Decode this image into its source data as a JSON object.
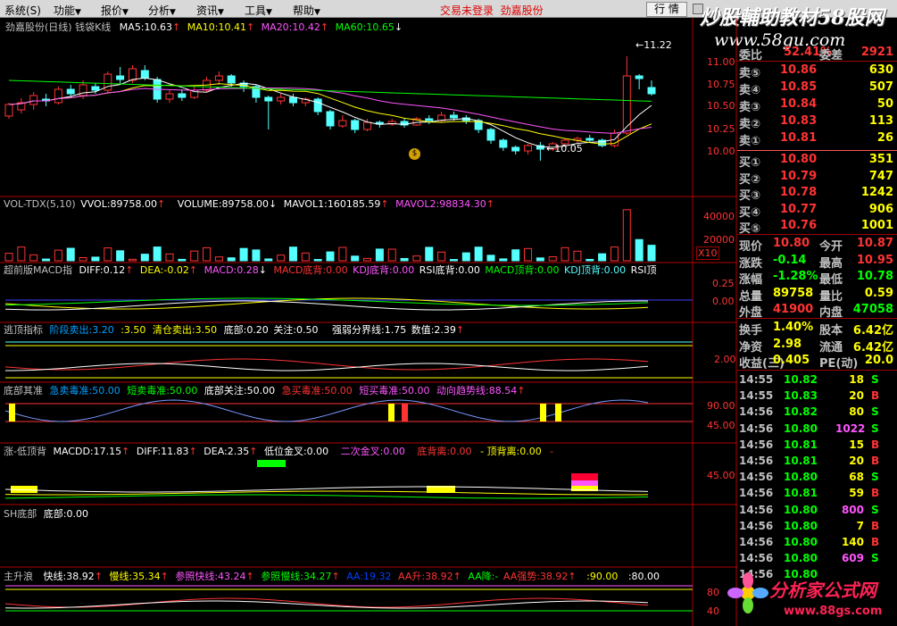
{
  "menu": [
    {
      "label": "系统(S)"
    },
    {
      "label": "功能"
    },
    {
      "label": "报价"
    },
    {
      "label": "分析"
    },
    {
      "label": "资讯"
    },
    {
      "label": "工具"
    },
    {
      "label": "帮助"
    }
  ],
  "trade_status": "交易未登录",
  "stock_name": "劲嘉股份",
  "market_button": "行 情",
  "watermark": {
    "title": "炒股輔助教材58股网",
    "url": "www.58gu.com",
    "logo": "分析家公式网",
    "logo_url": "www.88gs.com"
  },
  "colors": {
    "up": "#ff3333",
    "down": "#54ffff",
    "ma5": "#ffffff",
    "ma10": "#ffff00",
    "ma20": "#ff55ff",
    "ma60": "#00ff00",
    "panel_border": "#b00000"
  },
  "kline": {
    "header": {
      "title": "劲嘉股份(日线) 钱袋K线",
      "ma5": "MA5:10.63",
      "ma10": "MA10:10.41",
      "ma20": "MA20:10.42",
      "ma60": "MA60:10.65"
    },
    "price_labels": [
      "11.00",
      "10.75",
      "10.50",
      "10.25",
      "10.00"
    ],
    "high_label": "11.22",
    "low_label": "10.05"
  },
  "vol": {
    "header": {
      "name": "VOL-TDX(5,10)",
      "vvol": "VVOL:89758.00",
      "volume": "VOLUME:89758.00",
      "mavol1": "MAVOL1:160185.59",
      "mavol2": "MAVOL2:98834.30"
    },
    "axis": [
      "40000",
      "20000"
    ],
    "unit": "X10"
  },
  "macd": {
    "header": {
      "name": "超前版MACD指",
      "diff": "DIFF:0.12",
      "dea": "DEA:-0.02",
      "macd": "MACD:0.28",
      "macd_dibei": "MACD底背:0.00",
      "kdj_dibei": "KDJ底背:0.00",
      "rsi_dibei": "RSI底背:0.00",
      "macd_dingbei": "MACD顶背:0.00",
      "kdj_dingbei": "KDJ顶背:0.00",
      "rsi_ding": "RSI顶"
    },
    "axis": [
      "0.25",
      "0.00"
    ]
  },
  "escape": {
    "header": {
      "name": "逃顶指标",
      "stage_sell": "阶段卖出:3.20",
      "v350": ":3.50",
      "clear_sell": "清仓卖出:3.50",
      "bottom": "底部:0.20",
      "focus": "关注:0.50",
      "strong_weak": "强弱分界线:1.75",
      "value": "数值:2.39"
    },
    "axis": [
      "2.00"
    ]
  },
  "bottom": {
    "header": {
      "name": "底部其准",
      "fast_sell": "急卖毒准:50.00",
      "short_sell": "短卖毒准:50.00",
      "bottom_focus": "底部关注:50.00",
      "fast_buy": "急买毒准:50.00",
      "short_buy": "短买毒准:50.00",
      "trend": "动向趋势线:88.54"
    },
    "axis": [
      "90.00",
      "45.00"
    ]
  },
  "lowtop": {
    "header": {
      "name": "涨-低顶背",
      "macdd": "MACDD:17.15",
      "diff": "DIFF:11.83",
      "dea": "DEA:2.35",
      "low_gold": "低位金叉:0.00",
      "second_gold": "二次金叉:0.00",
      "dibei": "底背离:0.00",
      "dingbei": "- 顶背离:0.00",
      "dash": "-"
    },
    "axis": [
      "45.00"
    ]
  },
  "shbottom": {
    "header": {
      "name": "SH底部",
      "value": "底部:0.00"
    }
  },
  "main_rise": {
    "header": {
      "name": "主升浪",
      "fast": "快线:38.92",
      "slow": "慢线:35.34",
      "ref_fast": "参照快线:43.24",
      "ref_slow": "参照慢线:34.27",
      "aa1": "AA:19.32",
      "aa_up": "AA升:38.92",
      "aa_down": "AA降:-",
      "aa_strong": "AA强势:38.92",
      "v90": ":90.00",
      "v80": ":80.00"
    },
    "axis": [
      "80",
      "40"
    ]
  },
  "quote": {
    "header_labels": [
      "委比",
      "52.41%",
      "委差",
      "2921"
    ],
    "sell": [
      {
        "label": "卖⑤",
        "price": "10.86",
        "vol": "630"
      },
      {
        "label": "卖④",
        "price": "10.85",
        "vol": "507"
      },
      {
        "label": "卖③",
        "price": "10.84",
        "vol": "50"
      },
      {
        "label": "卖②",
        "price": "10.83",
        "vol": "113"
      },
      {
        "label": "卖①",
        "price": "10.81",
        "vol": "26"
      }
    ],
    "buy": [
      {
        "label": "买①",
        "price": "10.80",
        "vol": "351"
      },
      {
        "label": "买②",
        "price": "10.79",
        "vol": "747"
      },
      {
        "label": "买③",
        "price": "10.78",
        "vol": "1242"
      },
      {
        "label": "买④",
        "price": "10.77",
        "vol": "906"
      },
      {
        "label": "买⑤",
        "price": "10.76",
        "vol": "1001"
      }
    ],
    "stats": [
      {
        "l1": "现价",
        "v1": "10.80",
        "c1": "#ff3333",
        "l2": "今开",
        "v2": "10.87",
        "c2": "#ff3333"
      },
      {
        "l1": "涨跌",
        "v1": "-0.14",
        "c1": "#00ff00",
        "l2": "最高",
        "v2": "10.95",
        "c2": "#ff3333"
      },
      {
        "l1": "涨幅",
        "v1": "-1.28%",
        "c1": "#00ff00",
        "l2": "最低",
        "v2": "10.78",
        "c2": "#00ff00"
      },
      {
        "l1": "总量",
        "v1": "89758",
        "c1": "#ffff00",
        "l2": "量比",
        "v2": "0.59",
        "c2": "#ffff00"
      },
      {
        "l1": "外盘",
        "v1": "41900",
        "c1": "#ff3333",
        "l2": "内盘",
        "v2": "47058",
        "c2": "#00ff00"
      }
    ],
    "fin": [
      {
        "l1": "换手",
        "v1": "1.40%",
        "l2": "股本",
        "v2": "6.42亿"
      },
      {
        "l1": "净资",
        "v1": "2.98",
        "l2": "流通",
        "v2": "6.42亿"
      },
      {
        "l1": "收益(三)",
        "v1": "0.405",
        "l2": "PE(动)",
        "v2": "20.0"
      }
    ]
  },
  "ticks": [
    {
      "t": "14:55",
      "p": "10.82",
      "v": "18",
      "d": "S"
    },
    {
      "t": "14:55",
      "p": "10.83",
      "v": "20",
      "d": "B"
    },
    {
      "t": "14:56",
      "p": "10.82",
      "v": "80",
      "d": "S"
    },
    {
      "t": "14:56",
      "p": "10.80",
      "v": "1022",
      "d": "S"
    },
    {
      "t": "14:56",
      "p": "10.81",
      "v": "15",
      "d": "B"
    },
    {
      "t": "14:56",
      "p": "10.81",
      "v": "20",
      "d": "B"
    },
    {
      "t": "14:56",
      "p": "10.80",
      "v": "68",
      "d": "S"
    },
    {
      "t": "14:56",
      "p": "10.81",
      "v": "59",
      "d": "B"
    },
    {
      "t": "14:56",
      "p": "10.80",
      "v": "800",
      "d": "S"
    },
    {
      "t": "14:56",
      "p": "10.80",
      "v": "7",
      "d": "B"
    },
    {
      "t": "14:56",
      "p": "10.80",
      "v": "140",
      "d": "B"
    },
    {
      "t": "14:56",
      "p": "10.80",
      "v": "609",
      "d": "S"
    },
    {
      "t": "14:56",
      "p": "10.80",
      "v": "",
      "d": ""
    }
  ],
  "chart_data": {
    "type": "candlestick",
    "title": "劲嘉股份(日线) 钱袋K线",
    "ylim": [
      9.9,
      11.35
    ],
    "candles": [
      [
        10.55,
        10.68,
        10.52,
        10.7
      ],
      [
        10.62,
        10.7,
        10.58,
        10.75
      ],
      [
        10.68,
        10.78,
        10.62,
        10.82
      ],
      [
        10.74,
        10.72,
        10.66,
        10.8
      ],
      [
        10.7,
        10.85,
        10.68,
        10.88
      ],
      [
        10.85,
        10.8,
        10.76,
        10.9
      ],
      [
        10.78,
        10.9,
        10.74,
        10.95
      ],
      [
        10.88,
        10.84,
        10.8,
        10.92
      ],
      [
        10.84,
        11.02,
        10.8,
        11.05
      ],
      [
        11.0,
        10.96,
        10.9,
        11.1
      ],
      [
        10.95,
        11.08,
        10.92,
        11.12
      ],
      [
        11.06,
        10.98,
        10.95,
        11.12
      ],
      [
        10.96,
        10.74,
        10.7,
        10.99
      ],
      [
        10.74,
        10.8,
        10.7,
        10.84
      ],
      [
        10.8,
        10.76,
        10.72,
        10.85
      ],
      [
        10.76,
        10.84,
        10.74,
        10.88
      ],
      [
        10.84,
        10.95,
        10.82,
        10.99
      ],
      [
        10.95,
        11.0,
        10.9,
        11.05
      ],
      [
        11.0,
        10.92,
        10.88,
        11.02
      ],
      [
        10.92,
        10.88,
        10.82,
        10.95
      ],
      [
        10.88,
        10.76,
        10.7,
        10.9
      ],
      [
        10.76,
        10.72,
        10.4,
        10.78
      ],
      [
        10.72,
        10.76,
        10.68,
        10.8
      ],
      [
        10.76,
        10.7,
        10.66,
        10.8
      ],
      [
        10.7,
        10.74,
        10.66,
        10.76
      ],
      [
        10.74,
        10.6,
        10.56,
        10.76
      ],
      [
        10.6,
        10.44,
        10.4,
        10.62
      ],
      [
        10.44,
        10.5,
        10.42,
        10.56
      ],
      [
        10.5,
        10.4,
        10.36,
        10.52
      ],
      [
        10.4,
        10.48,
        10.38,
        10.52
      ],
      [
        10.48,
        10.46,
        10.42,
        10.5
      ],
      [
        10.46,
        10.49,
        10.44,
        10.52
      ],
      [
        10.49,
        10.45,
        10.42,
        10.52
      ],
      [
        10.45,
        10.52,
        10.44,
        10.54
      ],
      [
        10.52,
        10.5,
        10.46,
        10.56
      ],
      [
        10.5,
        10.56,
        10.48,
        10.6
      ],
      [
        10.56,
        10.53,
        10.5,
        10.6
      ],
      [
        10.53,
        10.5,
        10.46,
        10.56
      ],
      [
        10.5,
        10.4,
        10.36,
        10.52
      ],
      [
        10.4,
        10.28,
        10.24,
        10.42
      ],
      [
        10.28,
        10.2,
        10.16,
        10.3
      ],
      [
        10.2,
        10.16,
        10.12,
        10.22
      ],
      [
        10.16,
        10.22,
        10.12,
        10.24
      ],
      [
        10.22,
        10.18,
        10.05,
        10.26
      ],
      [
        10.18,
        10.24,
        10.16,
        10.26
      ],
      [
        10.24,
        10.28,
        10.22,
        10.3
      ],
      [
        10.28,
        10.3,
        10.24,
        10.32
      ],
      [
        10.3,
        10.28,
        10.26,
        10.34
      ],
      [
        10.28,
        10.22,
        10.2,
        10.3
      ],
      [
        10.22,
        10.36,
        10.2,
        10.4
      ],
      [
        10.36,
        11.0,
        10.34,
        11.22
      ],
      [
        11.0,
        10.97,
        10.85,
        11.02
      ],
      [
        10.87,
        10.8,
        10.78,
        10.95
      ]
    ]
  }
}
